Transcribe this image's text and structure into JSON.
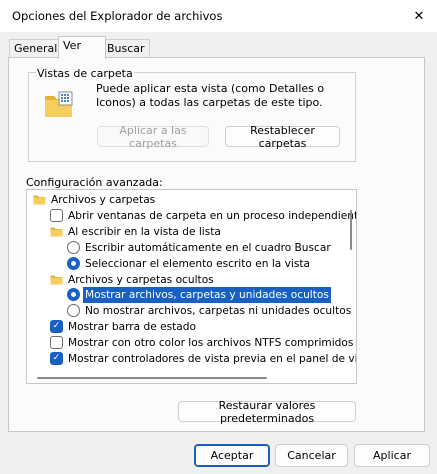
{
  "window": {
    "title": "Opciones del Explorador de archivos",
    "close_glyph": "✕"
  },
  "tabs": [
    {
      "label": "General"
    },
    {
      "label": "Ver"
    },
    {
      "label": "Buscar"
    }
  ],
  "folder_views": {
    "label": "Vistas de carpeta",
    "description": "Puede aplicar esta vista (como Detalles o Iconos) a todas las carpetas de este tipo.",
    "apply_button": "Aplicar a las carpetas",
    "reset_button": "Restablecer carpetas"
  },
  "advanced": {
    "label": "Configuración avanzada:",
    "items": [
      {
        "type": "folder",
        "level": 0,
        "text": "Archivos y carpetas"
      },
      {
        "type": "checkbox",
        "level": 1,
        "checked": false,
        "text": "Abrir ventanas de carpeta  en un proceso independiente"
      },
      {
        "type": "folder",
        "level": 1,
        "text": "Al escribir en la vista de lista"
      },
      {
        "type": "radio",
        "level": 2,
        "checked": false,
        "text": "Escribir automáticamente en el cuadro Buscar"
      },
      {
        "type": "radio",
        "level": 2,
        "checked": true,
        "text": "Seleccionar el elemento escrito en la vista"
      },
      {
        "type": "folder",
        "level": 1,
        "text": "Archivos y carpetas ocultos"
      },
      {
        "type": "radio",
        "level": 2,
        "checked": true,
        "selected": true,
        "text": "Mostrar archivos, carpetas y unidades ocultos"
      },
      {
        "type": "radio",
        "level": 2,
        "checked": false,
        "text": "No mostrar archivos, carpetas ni unidades ocultos"
      },
      {
        "type": "checkbox",
        "level": 1,
        "checked": true,
        "text": "Mostrar barra de estado"
      },
      {
        "type": "checkbox",
        "level": 1,
        "checked": false,
        "text": "Mostrar con otro color los archivos NTFS comprimidos o c"
      },
      {
        "type": "checkbox",
        "level": 1,
        "checked": true,
        "text": "Mostrar controladores de vista previa en el panel de vista"
      }
    ]
  },
  "restore_defaults_button": "Restaurar valores predeterminados",
  "footer": {
    "ok": "Aceptar",
    "cancel": "Cancelar",
    "apply": "Aplicar"
  },
  "colors": {
    "accent": "#1960c5",
    "folder": "#f2c44d"
  }
}
